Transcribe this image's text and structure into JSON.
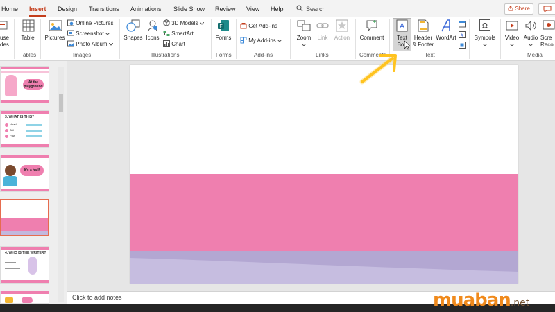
{
  "tabs": [
    "Home",
    "Insert",
    "Design",
    "Transitions",
    "Animations",
    "Slide Show",
    "Review",
    "View",
    "Help"
  ],
  "active_tab": "Insert",
  "search_label": "Search",
  "share_label": "Share",
  "ribbon": {
    "new_slide": [
      "use",
      "des"
    ],
    "table": "Table",
    "pictures": "Pictures",
    "online_pictures": "Online Pictures",
    "screenshot": "Screenshot",
    "photo_album": "Photo Album",
    "shapes": "Shapes",
    "icons": "Icons",
    "models_3d": "3D Models",
    "smartart": "SmartArt",
    "chart": "Chart",
    "forms": "Forms",
    "get_addins": "Get Add-ins",
    "my_addins": "My Add-ins",
    "zoom": "Zoom",
    "link": "Link",
    "action": "Action",
    "comment": "Comment",
    "text_box": [
      "Text",
      "Box"
    ],
    "header_footer": [
      "Header",
      "& Footer"
    ],
    "wordart": "WordArt",
    "symbols": "Symbols",
    "video": "Video",
    "audio": "Audio",
    "screen_recording": [
      "Scre",
      "Reco"
    ],
    "groups": {
      "tables": "Tables",
      "images": "Images",
      "illustrations": "Illustrations",
      "forms": "Forms",
      "addins": "Add-ins",
      "links": "Links",
      "comments": "Comments",
      "text": "Text",
      "media": "Media"
    }
  },
  "thumbnails": [
    {
      "title": "At the playground"
    },
    {
      "title": "3. WHAT IS THIS?",
      "items": [
        "Head",
        "Tail",
        "Paw"
      ]
    },
    {
      "title": "It's a ball!"
    },
    {
      "title": ""
    },
    {
      "title": "4. WHO IS THE WRITER?"
    },
    {
      "title": ""
    }
  ],
  "notes_placeholder": "Click to add notes",
  "watermark": "muaban",
  "watermark_tld": ".net",
  "colors": {
    "accent": "#c43e1c",
    "slide_pink": "#ef7faf",
    "slide_lavender": "#b7abd5",
    "arrow": "#ffc31f"
  }
}
